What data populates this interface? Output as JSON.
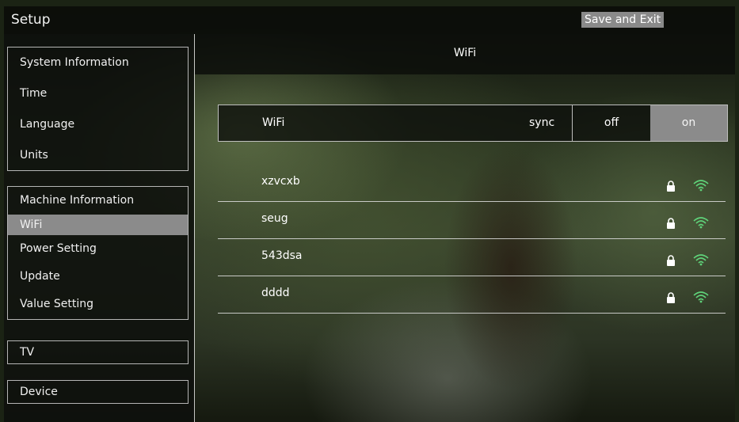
{
  "header": {
    "title": "Setup",
    "save_exit_label": "Save and Exit"
  },
  "sidebar": {
    "groups": [
      {
        "items": [
          "System Information",
          "Time",
          "Language",
          "Units"
        ]
      },
      {
        "items": [
          "Machine Information",
          "WiFi",
          "Power Setting",
          "Update",
          "Value Setting"
        ],
        "selected": "WiFi"
      },
      {
        "items": [
          "TV"
        ]
      },
      {
        "items": [
          "Device"
        ]
      }
    ]
  },
  "panel": {
    "title": "WiFi",
    "wifi_toggle": {
      "label": "WiFi",
      "sync_label": "sync",
      "off_label": "off",
      "on_label": "on",
      "selected": "on"
    },
    "networks": [
      {
        "ssid": "xzvcxb",
        "icons": [
          "lock-icon",
          "wifi-signal-icon"
        ]
      },
      {
        "ssid": "seug",
        "icons": [
          "lock-icon",
          "wifi-signal-icon"
        ]
      },
      {
        "ssid": "543dsa",
        "icons": [
          "lock-icon",
          "wifi-signal-icon"
        ]
      },
      {
        "ssid": "dddd",
        "icons": [
          "lock-icon",
          "wifi-signal-icon"
        ]
      }
    ]
  },
  "colors": {
    "selected_bg": "#8b8b8b",
    "signal": "#5fd37a",
    "bar_bg": "#0c0e0a"
  }
}
